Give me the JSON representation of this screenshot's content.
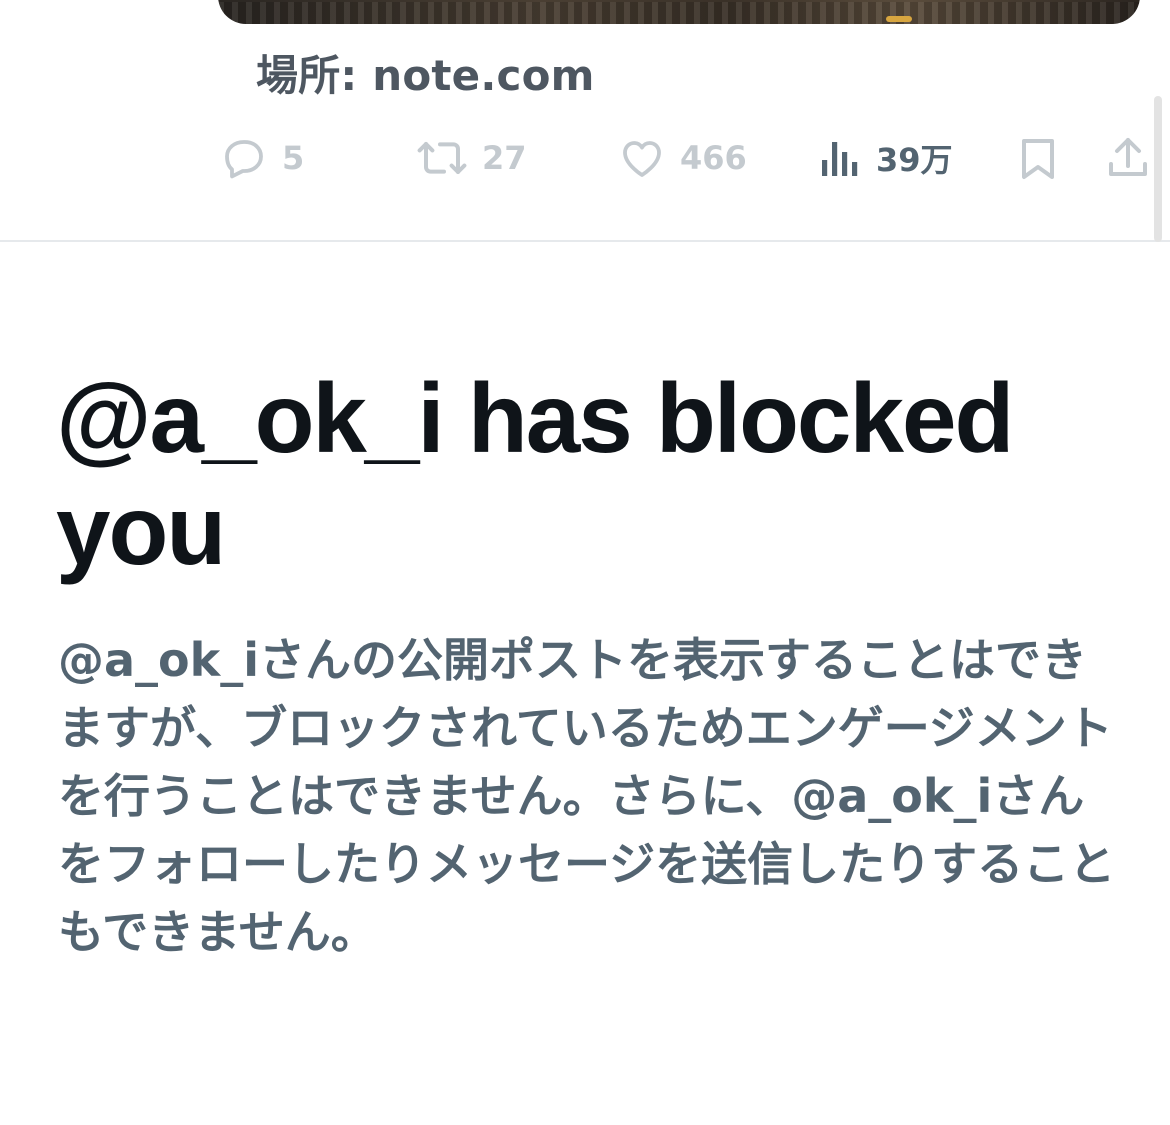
{
  "tweet": {
    "source_text": "場所: note.com",
    "actions": {
      "reply_count": "5",
      "repost_count": "27",
      "like_count": "466",
      "views_count": "39万"
    }
  },
  "blocked_notice": {
    "title": "@a_ok_i has blocked you",
    "body": "@a_ok_iさんの公開ポストを表示することはできますが、ブロックされているためエンゲージメントを行うことはできません。さらに、@a_ok_iさんをフォローしたりメッセージを送信したりすることもできません。"
  },
  "colors": {
    "title": "#0f1419",
    "secondary_text": "#536471",
    "muted_icon": "#c4cacf",
    "divider": "#e6e9ec"
  },
  "icons": [
    "reply-icon",
    "repost-icon",
    "like-icon",
    "views-icon",
    "bookmark-icon",
    "share-icon"
  ]
}
